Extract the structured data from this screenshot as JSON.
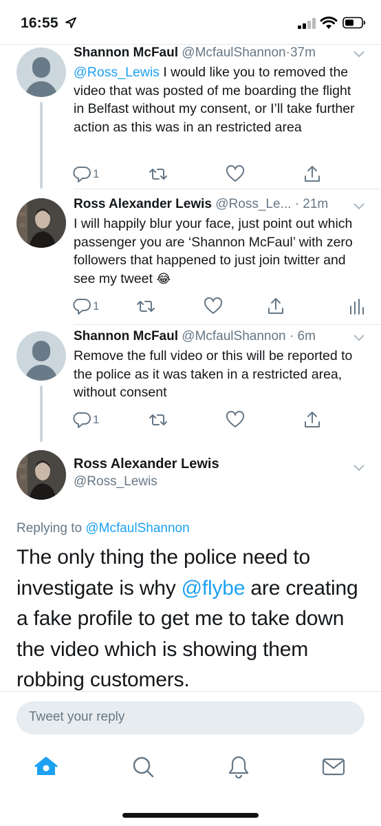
{
  "status": {
    "time": "16:55"
  },
  "tweets": [
    {
      "name": "Shannon McFaul",
      "handle": "@McfaulShannon",
      "sep": "·",
      "time": "37m",
      "mention": "@Ross_Lewis",
      "text": "I would like you to removed the video that was posted of me boarding the flight in Belfast without my consent, or I’ll take further action as this was in an restricted area",
      "reply_count": "1",
      "avatar": "default-avatar"
    },
    {
      "name": "Ross Alexander Lewis",
      "handle": "@Ross_Le...",
      "sep": "·",
      "time": "21m",
      "text": "I will happily blur your face, just point out which passenger you are ‘Shannon McFaul’ with zero followers that happened to just join twitter and see my tweet",
      "emoji": "😂",
      "reply_count": "1",
      "avatar": "photo-avatar"
    },
    {
      "name": "Shannon McFaul",
      "handle": "@McfaulShannon",
      "sep": "·",
      "time": "6m",
      "text": "Remove the full video or this will be reported to the police as it was taken in a restricted area, without consent",
      "reply_count": "1",
      "avatar": "default-avatar"
    }
  ],
  "main_tweet": {
    "name": "Ross Alexander Lewis",
    "handle": "@Ross_Lewis",
    "replying_prefix": "Replying to",
    "replying_to": "@McfaulShannon",
    "text_before": "The only thing the police need to investigate is why",
    "mention": "@flybe",
    "text_after": "are creating a fake profile to get me to take down the video which is showing them robbing customers."
  },
  "reply_bar": {
    "placeholder": "Tweet your reply"
  },
  "tabbar": {
    "items": [
      "home-icon",
      "search-icon",
      "notifications-icon",
      "messages-icon"
    ],
    "active": "home-icon",
    "accent": "#1da1f2"
  },
  "colors": {
    "accent": "#1da1f2",
    "secondary": "#657786",
    "divider": "#e1e8ed"
  }
}
